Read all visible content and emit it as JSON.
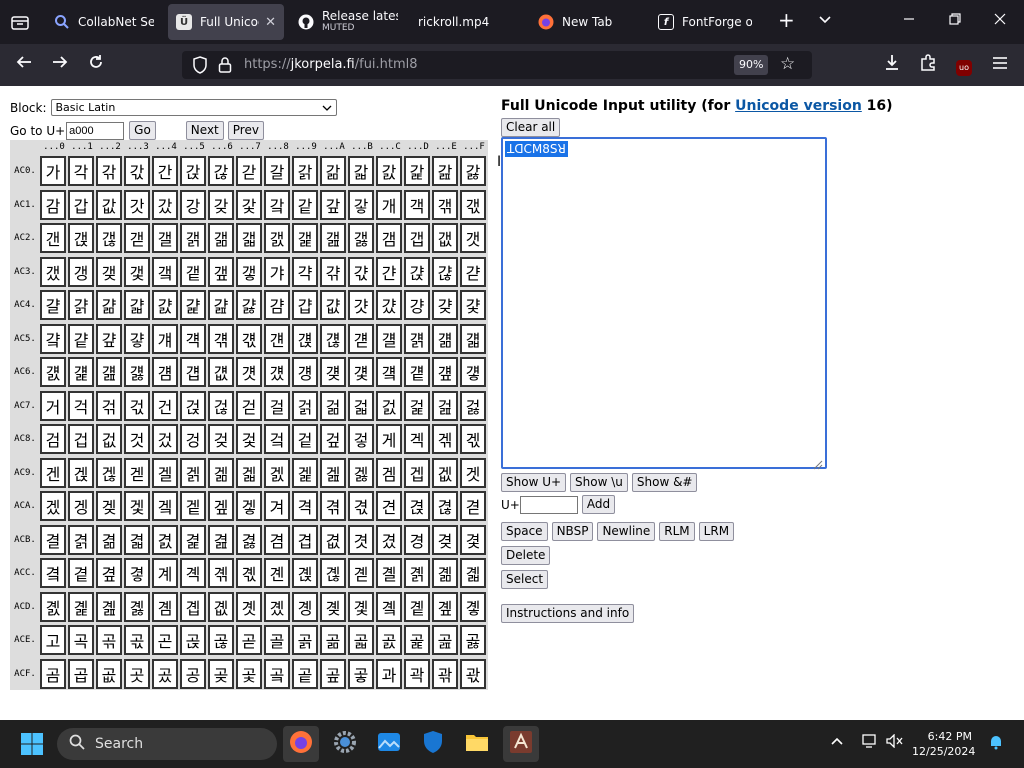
{
  "browser": {
    "tabs": [
      {
        "title": "CollabNet Sea",
        "icon": "search-favicon"
      },
      {
        "title": "Full Unicod",
        "icon": "unicode-favicon",
        "active": true
      },
      {
        "title": "Release latest",
        "subtitle": "MUTED",
        "icon": "github-favicon"
      },
      {
        "title": "rickroll.mp4",
        "icon": "none"
      },
      {
        "title": "New Tab",
        "icon": "firefox-favicon"
      },
      {
        "title": "FontForge on",
        "icon": "fontforge-favicon"
      }
    ],
    "new_tab": "+",
    "list_tabs": "⌄",
    "url_prefix": "https://",
    "url_host": "jkorpela.fi",
    "url_path": "/fui.html8",
    "zoom": "90%",
    "extension_badge": "uo"
  },
  "page": {
    "block_label": "Block:",
    "block_value": "Basic Latin",
    "goto_label": "Go to U+",
    "goto_value": "a000",
    "go_btn": "Go",
    "next_btn": "Next",
    "prev_btn": "Prev",
    "grid": {
      "columns": [
        "...0",
        "...1",
        "...2",
        "...3",
        "...4",
        "...5",
        "...6",
        "...7",
        "...8",
        "...9",
        "...A",
        "...B",
        "...C",
        "...D",
        "...E",
        "...F"
      ],
      "rows": [
        {
          "label": "AC0.",
          "chars": [
            "가",
            "각",
            "갂",
            "갃",
            "간",
            "갅",
            "갆",
            "갇",
            "갈",
            "갉",
            "갊",
            "갋",
            "갌",
            "갍",
            "갎",
            "갏"
          ]
        },
        {
          "label": "AC1.",
          "chars": [
            "감",
            "갑",
            "값",
            "갓",
            "갔",
            "강",
            "갖",
            "갗",
            "갘",
            "같",
            "갚",
            "갛",
            "개",
            "객",
            "갞",
            "갟"
          ]
        },
        {
          "label": "AC2.",
          "chars": [
            "갠",
            "갡",
            "갢",
            "갣",
            "갤",
            "갥",
            "갦",
            "갧",
            "갨",
            "갩",
            "갪",
            "갫",
            "갬",
            "갭",
            "갮",
            "갯"
          ]
        },
        {
          "label": "AC3.",
          "chars": [
            "갰",
            "갱",
            "갲",
            "갳",
            "갴",
            "갵",
            "갶",
            "갷",
            "갸",
            "갹",
            "갺",
            "갻",
            "갼",
            "갽",
            "갾",
            "갿"
          ]
        },
        {
          "label": "AC4.",
          "chars": [
            "걀",
            "걁",
            "걂",
            "걃",
            "걄",
            "걅",
            "걆",
            "걇",
            "걈",
            "걉",
            "걊",
            "걋",
            "걌",
            "걍",
            "걎",
            "걏"
          ]
        },
        {
          "label": "AC5.",
          "chars": [
            "걐",
            "걑",
            "걒",
            "걓",
            "걔",
            "걕",
            "걖",
            "걗",
            "걘",
            "걙",
            "걚",
            "걛",
            "걜",
            "걝",
            "걞",
            "걟"
          ]
        },
        {
          "label": "AC6.",
          "chars": [
            "걠",
            "걡",
            "걢",
            "걣",
            "걤",
            "걥",
            "걦",
            "걧",
            "걨",
            "걩",
            "걪",
            "걫",
            "걬",
            "걭",
            "걮",
            "걯"
          ]
        },
        {
          "label": "AC7.",
          "chars": [
            "거",
            "걱",
            "걲",
            "걳",
            "건",
            "걵",
            "걶",
            "걷",
            "걸",
            "걹",
            "걺",
            "걻",
            "걼",
            "걽",
            "걾",
            "걿"
          ]
        },
        {
          "label": "AC8.",
          "chars": [
            "검",
            "겁",
            "겂",
            "것",
            "겄",
            "겅",
            "겆",
            "겇",
            "겈",
            "겉",
            "겊",
            "겋",
            "게",
            "겍",
            "겎",
            "겏"
          ]
        },
        {
          "label": "AC9.",
          "chars": [
            "겐",
            "겑",
            "겒",
            "겓",
            "겔",
            "겕",
            "겖",
            "겗",
            "겘",
            "겙",
            "겚",
            "겛",
            "겜",
            "겝",
            "겞",
            "겟"
          ]
        },
        {
          "label": "ACA.",
          "chars": [
            "겠",
            "겡",
            "겢",
            "겣",
            "겤",
            "겥",
            "겦",
            "겧",
            "겨",
            "격",
            "겪",
            "겫",
            "견",
            "겭",
            "겮",
            "겯"
          ]
        },
        {
          "label": "ACB.",
          "chars": [
            "결",
            "겱",
            "겲",
            "겳",
            "겴",
            "겵",
            "겶",
            "겷",
            "겸",
            "겹",
            "겺",
            "겻",
            "겼",
            "경",
            "겾",
            "겿"
          ]
        },
        {
          "label": "ACC.",
          "chars": [
            "곀",
            "곁",
            "곂",
            "곃",
            "계",
            "곅",
            "곆",
            "곇",
            "곈",
            "곉",
            "곊",
            "곋",
            "곌",
            "곍",
            "곎",
            "곏"
          ]
        },
        {
          "label": "ACD.",
          "chars": [
            "곐",
            "곑",
            "곒",
            "곓",
            "곔",
            "곕",
            "곖",
            "곗",
            "곘",
            "곙",
            "곚",
            "곛",
            "곜",
            "곝",
            "곞",
            "곟"
          ]
        },
        {
          "label": "ACE.",
          "chars": [
            "고",
            "곡",
            "곢",
            "곣",
            "곤",
            "곥",
            "곦",
            "곧",
            "골",
            "곩",
            "곪",
            "곫",
            "곬",
            "곭",
            "곮",
            "곯"
          ]
        },
        {
          "label": "ACF.",
          "chars": [
            "곰",
            "곱",
            "곲",
            "곳",
            "곴",
            "공",
            "곶",
            "곷",
            "곸",
            "곹",
            "곺",
            "곻",
            "과",
            "곽",
            "곾",
            "곿"
          ]
        }
      ]
    },
    "util_title_pre": "Full Unicode Input utility (for ",
    "util_title_link": "Unicode version",
    "util_title_post": " 16)",
    "clear_btn": "Clear all",
    "textarea_content": "ꓕꓷꓚꓟ8ꓢꓤ",
    "show_uplus": "Show U+",
    "show_u": "Show \\u",
    "show_amp": "Show &#",
    "uplus_label": "U+",
    "add_btn": "Add",
    "space_btn": "Space",
    "nbsp_btn": "NBSP",
    "newline_btn": "Newline",
    "rlm_btn": "RLM",
    "lrm_btn": "LRM",
    "delete_btn": "Delete",
    "select_btn": "Select",
    "instructions_btn": "Instructions and info"
  },
  "taskbar": {
    "search_label": "Search",
    "time": "6:42 PM",
    "date": "12/25/2024"
  }
}
